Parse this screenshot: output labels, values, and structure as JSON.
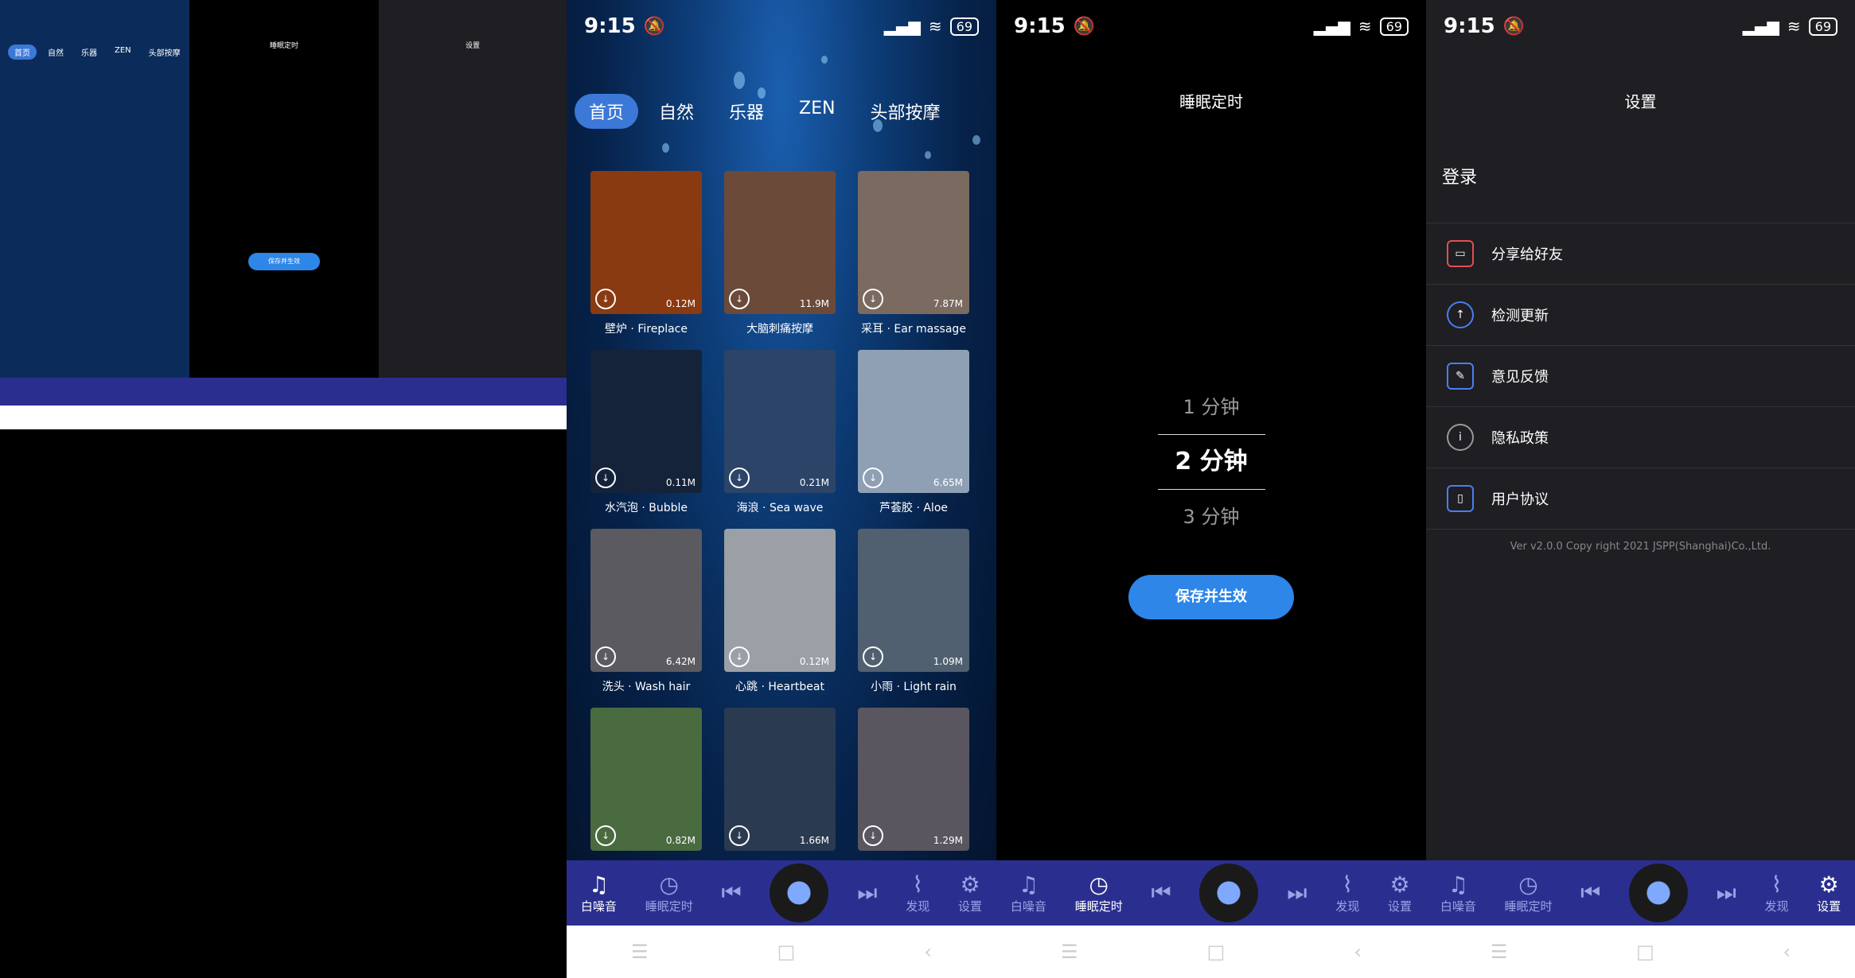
{
  "status": {
    "time": "9:15",
    "battery": "69"
  },
  "tabs": [
    "首页",
    "自然",
    "乐器",
    "ZEN",
    "头部按摩"
  ],
  "cards": [
    {
      "label": "壁炉 · Fireplace",
      "size": "0.12M",
      "color": "#8a3a10"
    },
    {
      "label": "大脑刺痛按摩",
      "size": "11.9M",
      "color": "#6b4a3a"
    },
    {
      "label": "采耳 · Ear massage",
      "size": "7.87M",
      "color": "#7a6a60"
    },
    {
      "label": "水汽泡 · Bubble",
      "size": "0.11M",
      "color": "#14233a"
    },
    {
      "label": "海浪 · Sea wave",
      "size": "0.21M",
      "color": "#2c4468"
    },
    {
      "label": "芦荟胶 · Aloe",
      "size": "6.65M",
      "color": "#8fa0b5"
    },
    {
      "label": "洗头 · Wash hair",
      "size": "6.42M",
      "color": "#5a5a60"
    },
    {
      "label": "心跳 · Heartbeat",
      "size": "0.12M",
      "color": "#9aa0a6"
    },
    {
      "label": "小雨 · Light rain",
      "size": "1.09M",
      "color": "#506070"
    },
    {
      "label": "",
      "size": "0.82M",
      "color": "#4a6a40"
    },
    {
      "label": "",
      "size": "1.66M",
      "color": "#2a3a50"
    },
    {
      "label": "",
      "size": "1.29M",
      "color": "#5a5660"
    }
  ],
  "nav": {
    "white_noise": "白噪音",
    "sleep_timer": "睡眠定时",
    "discover": "发现",
    "settings": "设置"
  },
  "sleep": {
    "title": "睡眠定时",
    "options": [
      "1 分钟",
      "2 分钟",
      "3 分钟"
    ],
    "save": "保存并生效"
  },
  "settings": {
    "title": "设置",
    "login": "登录",
    "rows": [
      "分享给好友",
      "检测更新",
      "意见反馈",
      "隐私政策",
      "用户协议"
    ],
    "version": "Ver v2.0.0 Copy right  2021 JSPP(Shanghai)Co.,Ltd."
  }
}
